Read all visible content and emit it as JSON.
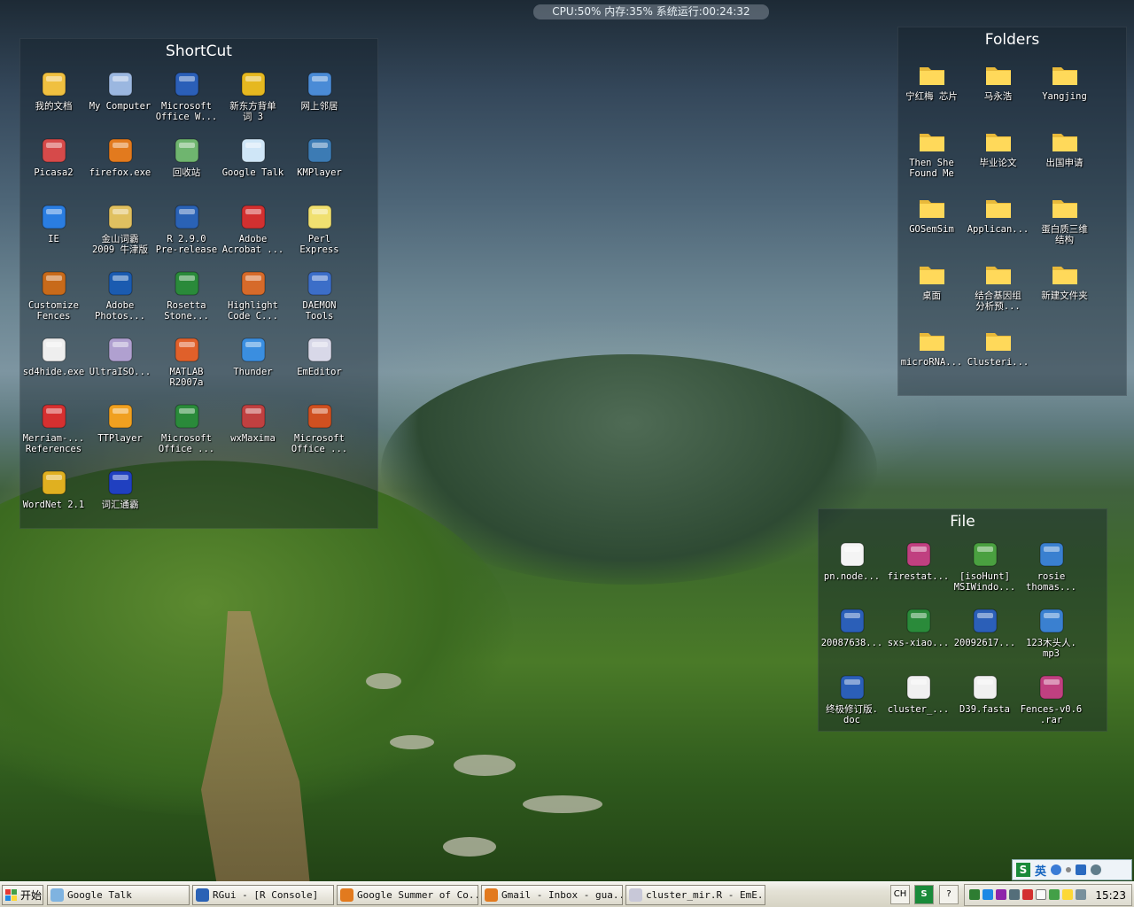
{
  "system_monitor": "CPU:50% 内存:35% 系统运行:00:24:32",
  "fences": {
    "shortcut": {
      "title": "ShortCut",
      "items": [
        {
          "label": "我的文档",
          "icon": "my-documents-icon",
          "color": "#f0c040"
        },
        {
          "label": "My Computer",
          "icon": "my-computer-icon",
          "color": "#9bb7e0"
        },
        {
          "label": "Microsoft\nOffice W...",
          "icon": "word-icon",
          "color": "#2b5fb8"
        },
        {
          "label": "新东方背单\n词 3",
          "icon": "bee-icon",
          "color": "#e6b820"
        },
        {
          "label": "网上邻居",
          "icon": "network-places-icon",
          "color": "#4a8bd6"
        },
        {
          "label": "Picasa2",
          "icon": "picasa-icon",
          "color": "#d64a4a"
        },
        {
          "label": "firefox.exe",
          "icon": "firefox-icon",
          "color": "#e27a1e"
        },
        {
          "label": "回收站",
          "icon": "recycle-bin-icon",
          "color": "#6fb56f"
        },
        {
          "label": "Google Talk",
          "icon": "google-talk-icon",
          "color": "#cfe6f7"
        },
        {
          "label": "KMPlayer",
          "icon": "kmplayer-icon",
          "color": "#3c7bb4"
        },
        {
          "label": "IE",
          "icon": "internet-explorer-icon",
          "color": "#2a7de1"
        },
        {
          "label": "金山词霸\n2009 牛津版",
          "icon": "dictionary-icon",
          "color": "#e0c060"
        },
        {
          "label": "R 2.9.0\nPre-release",
          "icon": "r-language-icon",
          "color": "#2a62b5"
        },
        {
          "label": "Adobe\nAcrobat ...",
          "icon": "adobe-acrobat-icon",
          "color": "#d23030"
        },
        {
          "label": "Perl\nExpress",
          "icon": "perl-icon",
          "color": "#f0e070"
        },
        {
          "label": "Customize\nFences",
          "icon": "fences-icon",
          "color": "#c86a1a"
        },
        {
          "label": "Adobe\nPhotos...",
          "icon": "photoshop-icon",
          "color": "#1b5bb0"
        },
        {
          "label": "Rosetta\nStone...",
          "icon": "rosetta-stone-icon",
          "color": "#2a8a3a"
        },
        {
          "label": "Highlight\nCode C...",
          "icon": "parrot-icon",
          "color": "#d66a2a"
        },
        {
          "label": "DAEMON\nTools",
          "icon": "daemon-tools-icon",
          "color": "#3c6ec8"
        },
        {
          "label": "sd4hide.exe",
          "icon": "skull-icon",
          "color": "#eeeeee"
        },
        {
          "label": "UltraISO...",
          "icon": "disc-icon",
          "color": "#b0a0d0"
        },
        {
          "label": "MATLAB\nR2007a",
          "icon": "matlab-icon",
          "color": "#e0602a"
        },
        {
          "label": "Thunder",
          "icon": "thunder-icon",
          "color": "#3a8ee0"
        },
        {
          "label": "EmEditor",
          "icon": "emeditor-icon",
          "color": "#d8d8e8"
        },
        {
          "label": "Merriam-...\nReferences",
          "icon": "merriam-webster-icon",
          "color": "#d63030"
        },
        {
          "label": "TTPlayer",
          "icon": "ttplayer-icon",
          "color": "#f0a020"
        },
        {
          "label": "Microsoft\nOffice ...",
          "icon": "excel-icon",
          "color": "#2a8a3a"
        },
        {
          "label": "wxMaxima",
          "icon": "wxmaxima-icon",
          "color": "#c04040"
        },
        {
          "label": "Microsoft\nOffice ...",
          "icon": "powerpoint-icon",
          "color": "#d05020"
        },
        {
          "label": "WordNet 2.1",
          "icon": "wordnet-icon",
          "color": "#e0b020"
        },
        {
          "label": "词汇通霸",
          "icon": "vocabulary-icon",
          "color": "#2040c0"
        }
      ]
    },
    "folders": {
      "title": "Folders",
      "items": [
        {
          "label": "宁红梅 芯片",
          "icon": "folder-icon"
        },
        {
          "label": "马永浩",
          "icon": "folder-icon"
        },
        {
          "label": "Yangjing",
          "icon": "folder-icon"
        },
        {
          "label": "Then She\nFound Me",
          "icon": "folder-icon"
        },
        {
          "label": "毕业论文",
          "icon": "folder-icon"
        },
        {
          "label": "出国申请",
          "icon": "folder-icon"
        },
        {
          "label": "GOSemSim",
          "icon": "folder-icon"
        },
        {
          "label": "Applican...",
          "icon": "folder-icon"
        },
        {
          "label": "蛋白质三维\n结构",
          "icon": "folder-icon"
        },
        {
          "label": "桌面",
          "icon": "folder-icon"
        },
        {
          "label": "结合基因组\n分析预...",
          "icon": "folder-icon"
        },
        {
          "label": "新建文件夹",
          "icon": "folder-icon"
        },
        {
          "label": "microRNA...",
          "icon": "folder-icon"
        },
        {
          "label": "Clusteri...",
          "icon": "folder-icon"
        }
      ]
    },
    "file": {
      "title": "File",
      "items": [
        {
          "label": "pn.node...",
          "icon": "document-icon",
          "color": "#f4f4f4"
        },
        {
          "label": "firestat...",
          "icon": "winrar-icon",
          "color": "#c04080"
        },
        {
          "label": "[isoHunt]\nMSIWindo...",
          "icon": "torrent-icon",
          "color": "#4aa040"
        },
        {
          "label": "rosie\nthomas...",
          "icon": "media-file-icon",
          "color": "#3a80d0"
        },
        {
          "label": "20087638...",
          "icon": "word-document-icon",
          "color": "#2b5fb8"
        },
        {
          "label": "sxs-xiao...",
          "icon": "excel-document-icon",
          "color": "#2a8a3a"
        },
        {
          "label": "20092617...",
          "icon": "word-document-icon",
          "color": "#2b5fb8"
        },
        {
          "label": "123木头人.\nmp3",
          "icon": "media-file-icon",
          "color": "#3a80d0"
        },
        {
          "label": "终极修订版.\ndoc",
          "icon": "word-document-icon",
          "color": "#2b5fb8"
        },
        {
          "label": "cluster_...",
          "icon": "text-file-icon",
          "color": "#f0f0f0"
        },
        {
          "label": "D39.fasta",
          "icon": "text-file-icon",
          "color": "#f0f0f0"
        },
        {
          "label": "Fences-v0.6\n.rar",
          "icon": "winrar-icon",
          "color": "#c04080"
        }
      ]
    }
  },
  "taskbar": {
    "start_label": "开始",
    "tasks": [
      {
        "label": "Google Talk",
        "icon": "google-talk-icon"
      },
      {
        "label": "RGui - [R Console]",
        "icon": "r-language-icon"
      },
      {
        "label": "Google Summer of Co...",
        "icon": "firefox-icon"
      },
      {
        "label": "Gmail - Inbox - gua...",
        "icon": "firefox-icon"
      },
      {
        "label": "cluster_mir.R - EmE...",
        "icon": "emeditor-icon"
      }
    ],
    "quick": {
      "ch": "CH",
      "s": "S",
      "help": "?"
    },
    "clock": "15:23"
  },
  "ime": {
    "label": "英"
  }
}
